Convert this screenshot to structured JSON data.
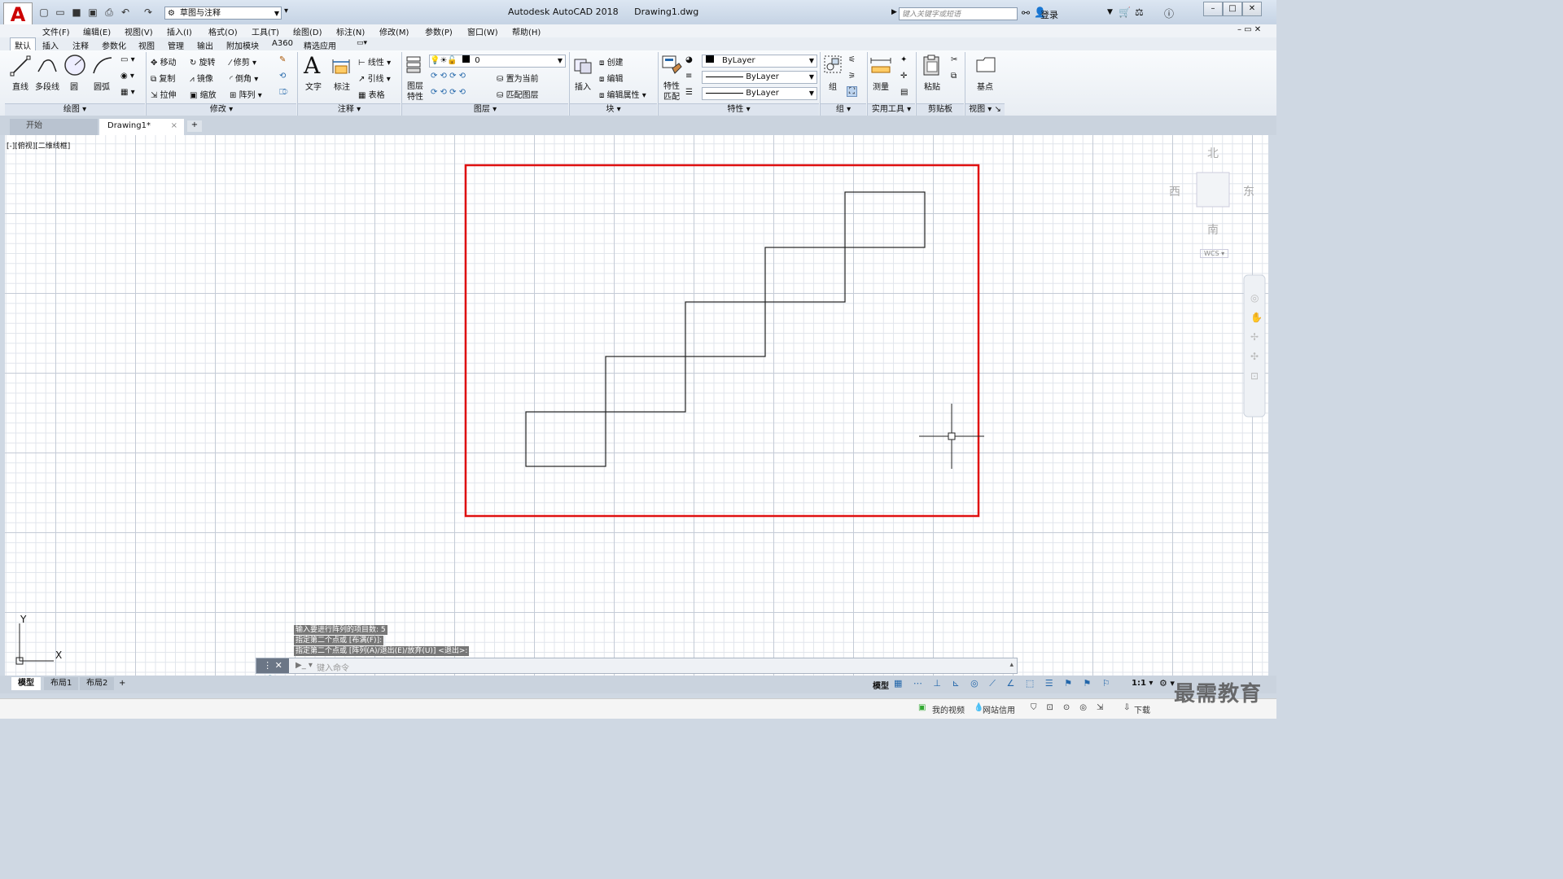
{
  "window": {
    "app_title": "Autodesk AutoCAD 2018",
    "file_name": "Drawing1.dwg",
    "logo_letter": "A"
  },
  "quick_access": {
    "workspace": "草图与注释"
  },
  "search": {
    "placeholder": "键入关键字或短语"
  },
  "user": {
    "login_label": "登录"
  },
  "menu": [
    "文件(F)",
    "编辑(E)",
    "视图(V)",
    "插入(I)",
    "格式(O)",
    "工具(T)",
    "绘图(D)",
    "标注(N)",
    "修改(M)",
    "参数(P)",
    "窗口(W)",
    "帮助(H)"
  ],
  "ribbon_tabs": [
    "默认",
    "插入",
    "注释",
    "参数化",
    "视图",
    "管理",
    "输出",
    "附加模块",
    "A360",
    "精选应用"
  ],
  "ribbon": {
    "draw": {
      "title": "绘图",
      "line": "直线",
      "polyline": "多段线",
      "circle": "圆",
      "arc": "圆弧"
    },
    "modify": {
      "title": "修改",
      "move": "移动",
      "rotate": "旋转",
      "trim": "修剪",
      "copy": "复制",
      "mirror": "镜像",
      "fillet": "倒角",
      "stretch": "拉伸",
      "scale": "缩放",
      "array": "阵列"
    },
    "annotation": {
      "title": "注释",
      "text": "文字",
      "dimension": "标注",
      "linear": "线性",
      "leader": "引线",
      "table": "表格"
    },
    "layers": {
      "title": "图层",
      "layer_props": "图层",
      "layer_props2": "特性",
      "current_layer": "0",
      "set_current": "置为当前",
      "match_layer": "匹配图层"
    },
    "block": {
      "title": "块",
      "insert": "插入",
      "create": "创建",
      "edit": "编辑",
      "edit_attr": "编辑属性"
    },
    "properties": {
      "title": "特性",
      "match": "特性",
      "match2": "匹配",
      "color": "ByLayer",
      "linetype": "ByLayer",
      "lineweight": "ByLayer"
    },
    "groups": {
      "title": "组",
      "group": "组"
    },
    "utilities": {
      "title": "实用工具",
      "measure": "测量"
    },
    "clipboard": {
      "title": "剪贴板",
      "paste": "粘贴"
    },
    "view": {
      "title": "视图",
      "base": "基点"
    }
  },
  "file_tabs": {
    "start": "开始",
    "drawing": "Drawing1*"
  },
  "viewport": {
    "label": "[-][俯视][二维线框]"
  },
  "viewcube": {
    "north": "北",
    "south": "南",
    "east": "东",
    "west": "西",
    "wcs": "WCS"
  },
  "ucs": {
    "x": "X",
    "y": "Y"
  },
  "command": {
    "history": [
      "输入要进行阵列的项目数: 5",
      "指定第二个点或 [布满(F)]:",
      "指定第二个点或 [阵列(A)/退出(E)/放弃(U)] <退出>:"
    ],
    "placeholder": "键入命令"
  },
  "layout_tabs": [
    "模型",
    "布局1",
    "布局2"
  ],
  "status": {
    "model": "模型",
    "scale": "1:1"
  },
  "taskbar": {
    "my_video": "我的视频",
    "net_credit": "网站信用",
    "download": "下载"
  },
  "watermark": "最需教育",
  "colors": {
    "highlight_rect": "#e01010",
    "drawing_lines": "#222222"
  }
}
